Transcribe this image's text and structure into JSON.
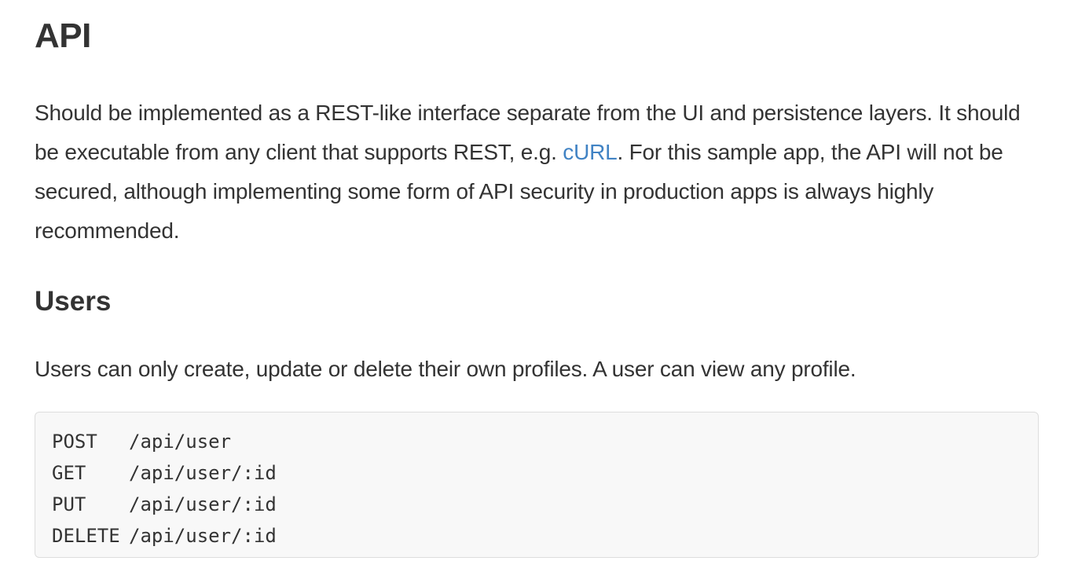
{
  "section": {
    "title": "API",
    "intro": {
      "before_link": "Should be implemented as a REST-like interface separate from the UI and persistence layers. It should be executable from any client that supports REST, e.g. ",
      "link_text": "cURL",
      "after_link": ". For this sample app, the API will not be secured, although implementing some form of API security in production apps is always highly recommended."
    }
  },
  "users": {
    "title": "Users",
    "description": "Users can only create, update or delete their own profiles. A user can view any profile.",
    "endpoints": [
      {
        "method": "POST",
        "path": "/api/user"
      },
      {
        "method": "GET",
        "path": "/api/user/:id"
      },
      {
        "method": "PUT",
        "path": "/api/user/:id"
      },
      {
        "method": "DELETE",
        "path": "/api/user/:id"
      }
    ]
  },
  "colors": {
    "text": "#333333",
    "link": "#4183c4",
    "code_background": "#f8f8f8",
    "code_border": "#dddddd"
  }
}
